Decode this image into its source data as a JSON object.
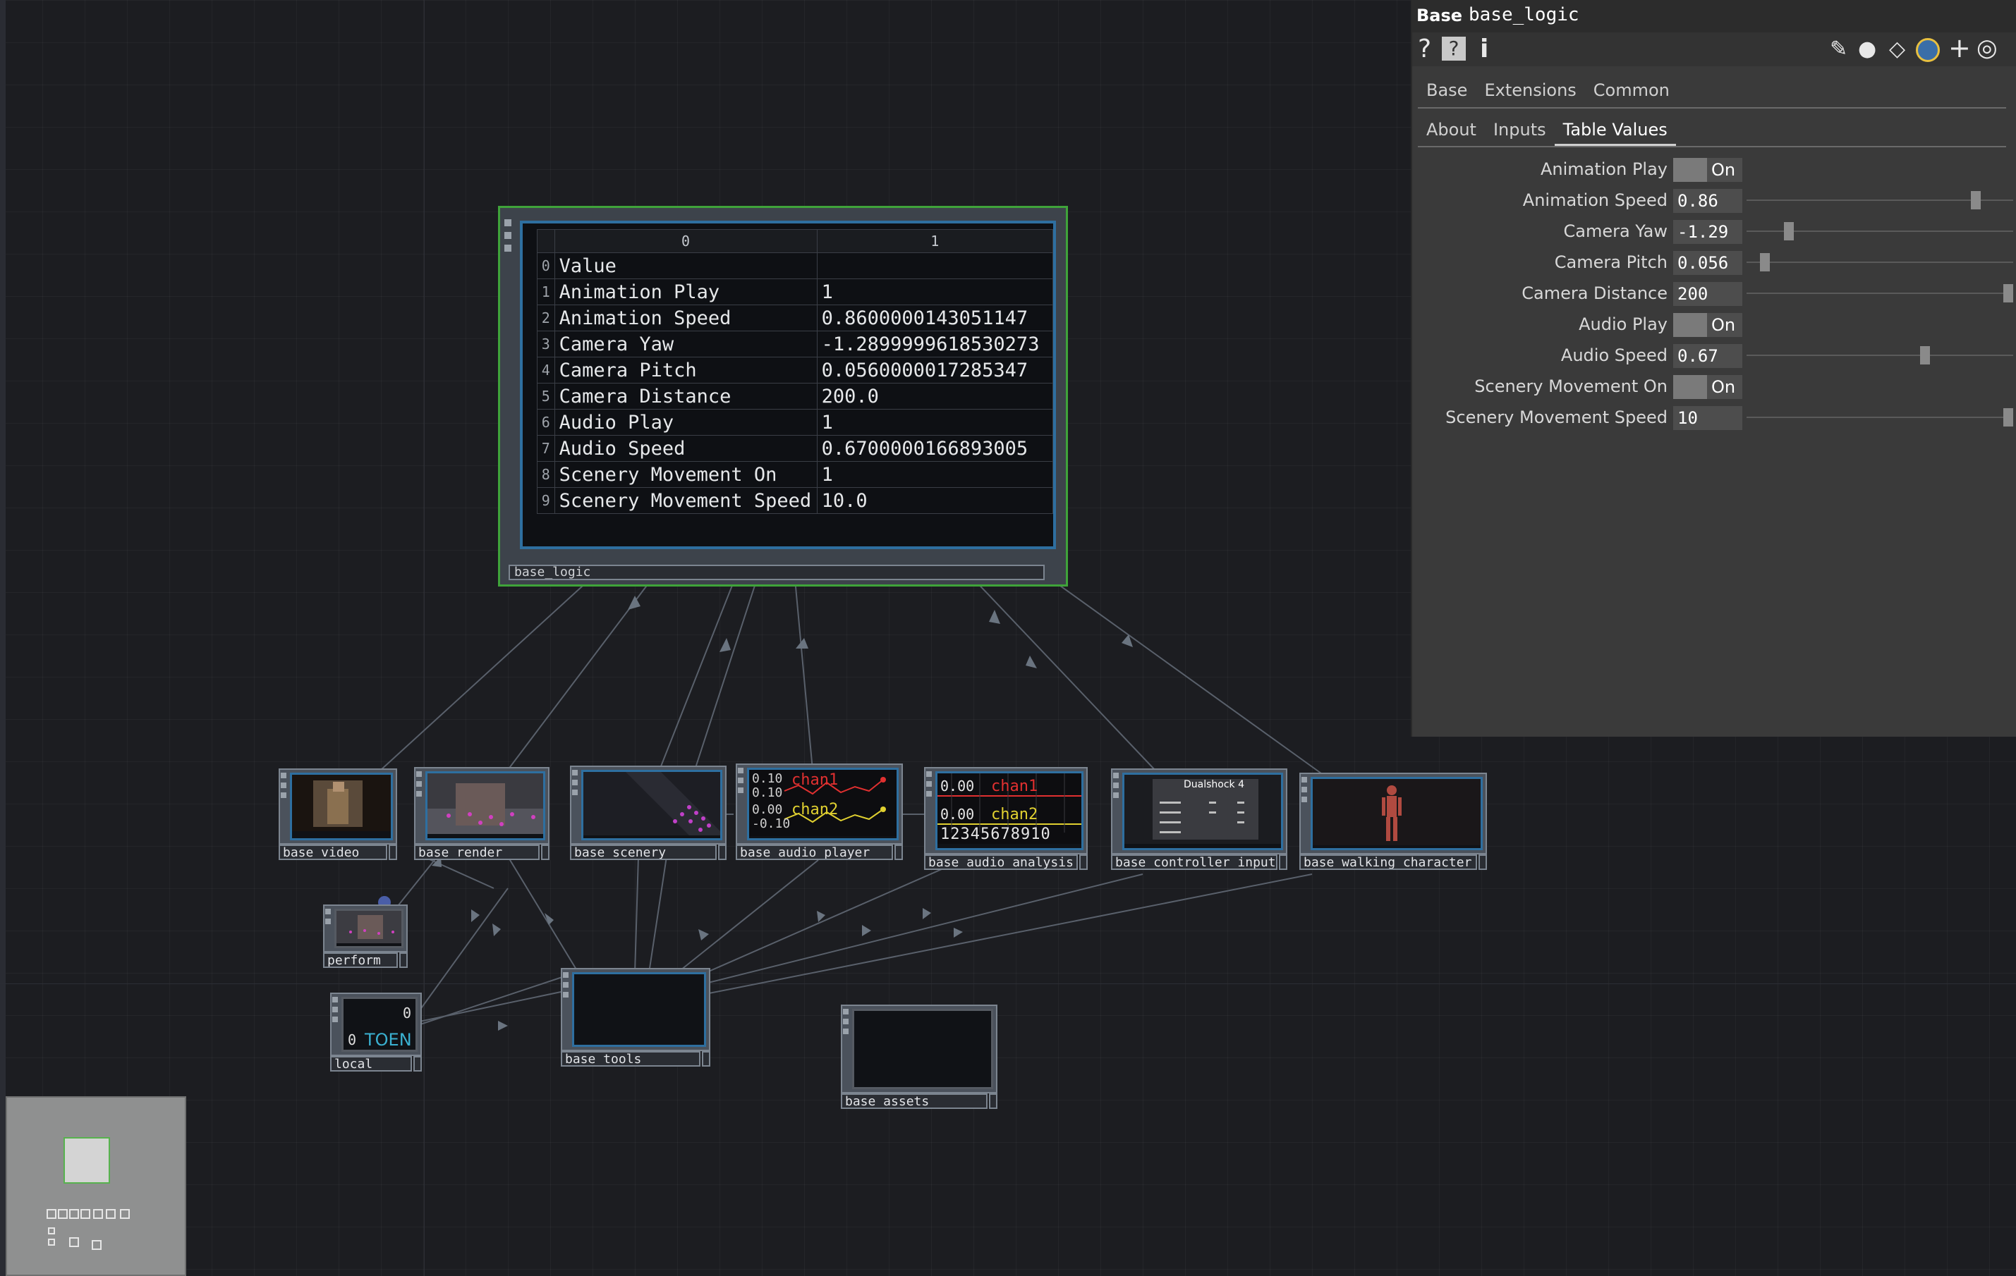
{
  "network": {
    "logic_node": {
      "label": "base_logic",
      "column_headers": [
        "0",
        "1"
      ],
      "rows": [
        {
          "index": "0",
          "name": "Value",
          "value": ""
        },
        {
          "index": "1",
          "name": "Animation Play",
          "value": "1"
        },
        {
          "index": "2",
          "name": "Animation Speed",
          "value": "0.8600000143051147"
        },
        {
          "index": "3",
          "name": "Camera Yaw",
          "value": "-1.2899999618530273"
        },
        {
          "index": "4",
          "name": "Camera Pitch",
          "value": "0.0560000017285347"
        },
        {
          "index": "5",
          "name": "Camera Distance",
          "value": "200.0"
        },
        {
          "index": "6",
          "name": "Audio Play",
          "value": "1"
        },
        {
          "index": "7",
          "name": "Audio Speed",
          "value": "0.6700000166893005"
        },
        {
          "index": "8",
          "name": "Scenery Movement On",
          "value": "1"
        },
        {
          "index": "9",
          "name": "Scenery Movement Speed",
          "value": "10.0"
        }
      ]
    },
    "nodes": {
      "base_video": "base_video",
      "base_render": "base_render",
      "base_scenery": "base_scenery",
      "base_audio_player": "base_audio_player",
      "base_audio_analysis": "base_audio_analysis",
      "base_controller_input": "base_controller_input",
      "base_walking_character": "base_walking_character",
      "perform": "perform",
      "local": "local",
      "base_tools": "base_tools",
      "base_assets": "base_assets"
    },
    "audio_player_viewer": {
      "chan1": "chan1",
      "chan2": "chan2",
      "v1a": "0.10",
      "v1b": "0.10",
      "v2a": "0.00",
      "v2b": "-0.10"
    },
    "audio_analysis_viewer": {
      "chan1": "chan1",
      "chan2": "chan2",
      "v1": "0.00",
      "v2": "0.00",
      "axis": "12345678910"
    },
    "controller_viewer": {
      "title": "Dualshock 4"
    },
    "local_viewer": {
      "top_value": "0",
      "bottom_value": "0",
      "label": "TOEN"
    }
  },
  "panel": {
    "op_type": "Base",
    "op_name": "base_logic",
    "page_tabs": [
      "Base",
      "Extensions",
      "Common"
    ],
    "sub_tabs": [
      "About",
      "Inputs",
      "Table Values"
    ],
    "active_sub_tab": "Table Values",
    "params": [
      {
        "label": "Animation Play",
        "kind": "toggle",
        "value": "On"
      },
      {
        "label": "Animation Speed",
        "kind": "slider",
        "value": "0.86",
        "fraction": 0.86
      },
      {
        "label": "Camera Yaw",
        "kind": "slider",
        "value": "-1.29",
        "fraction": 0.16
      },
      {
        "label": "Camera Pitch",
        "kind": "slider",
        "value": "0.056",
        "fraction": 0.07
      },
      {
        "label": "Camera Distance",
        "kind": "slider",
        "value": "200",
        "fraction": 1.0
      },
      {
        "label": "Audio Play",
        "kind": "toggle",
        "value": "On"
      },
      {
        "label": "Audio Speed",
        "kind": "slider",
        "value": "0.67",
        "fraction": 0.67
      },
      {
        "label": "Scenery Movement On",
        "kind": "toggle",
        "value": "On"
      },
      {
        "label": "Scenery Movement Speed",
        "kind": "slider",
        "value": "10",
        "fraction": 1.0
      }
    ]
  },
  "colors": {
    "selected_outline": "#3fa33a",
    "node_inner_border": "#2e6fa0",
    "panel_bg": "#3a3a3a",
    "canvas_bg": "#1c1d21"
  }
}
